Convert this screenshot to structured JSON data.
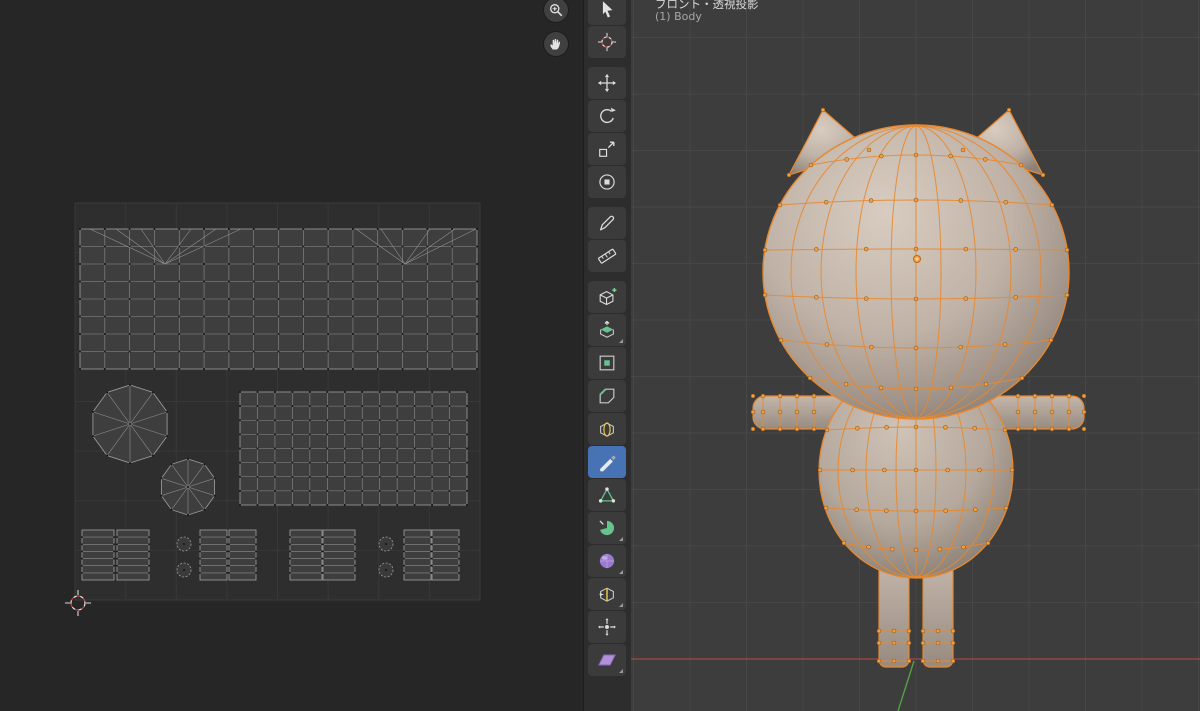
{
  "header": {
    "view_mode": "フロント・透視投影",
    "active_object": "(1) Body"
  },
  "toolbar": {
    "tools": [
      {
        "name": "select-box"
      },
      {
        "name": "cursor"
      },
      {
        "name": "move",
        "sep_before": true
      },
      {
        "name": "rotate"
      },
      {
        "name": "scale"
      },
      {
        "name": "transform"
      },
      {
        "name": "annotate",
        "sep_before": true
      },
      {
        "name": "measure"
      },
      {
        "name": "add-cube",
        "sep_before": true
      },
      {
        "name": "extrude-region",
        "more": true
      },
      {
        "name": "inset-faces"
      },
      {
        "name": "bevel"
      },
      {
        "name": "loop-cut"
      },
      {
        "name": "knife",
        "active": true
      },
      {
        "name": "poly-build"
      },
      {
        "name": "spin",
        "more": true
      },
      {
        "name": "smooth",
        "more": true
      },
      {
        "name": "edge-slide",
        "more": true
      },
      {
        "name": "shrink-fatten"
      },
      {
        "name": "shear",
        "more": true
      }
    ]
  },
  "uv_editor": {
    "controls": [
      {
        "name": "zoom"
      },
      {
        "name": "pan"
      }
    ]
  },
  "colors": {
    "active_tool": "#4772b3",
    "selection_orange": "#e8882e",
    "mesh_fill": "#c5b6aa",
    "axis_x": "#9e4a44",
    "axis_y": "#55a046"
  }
}
